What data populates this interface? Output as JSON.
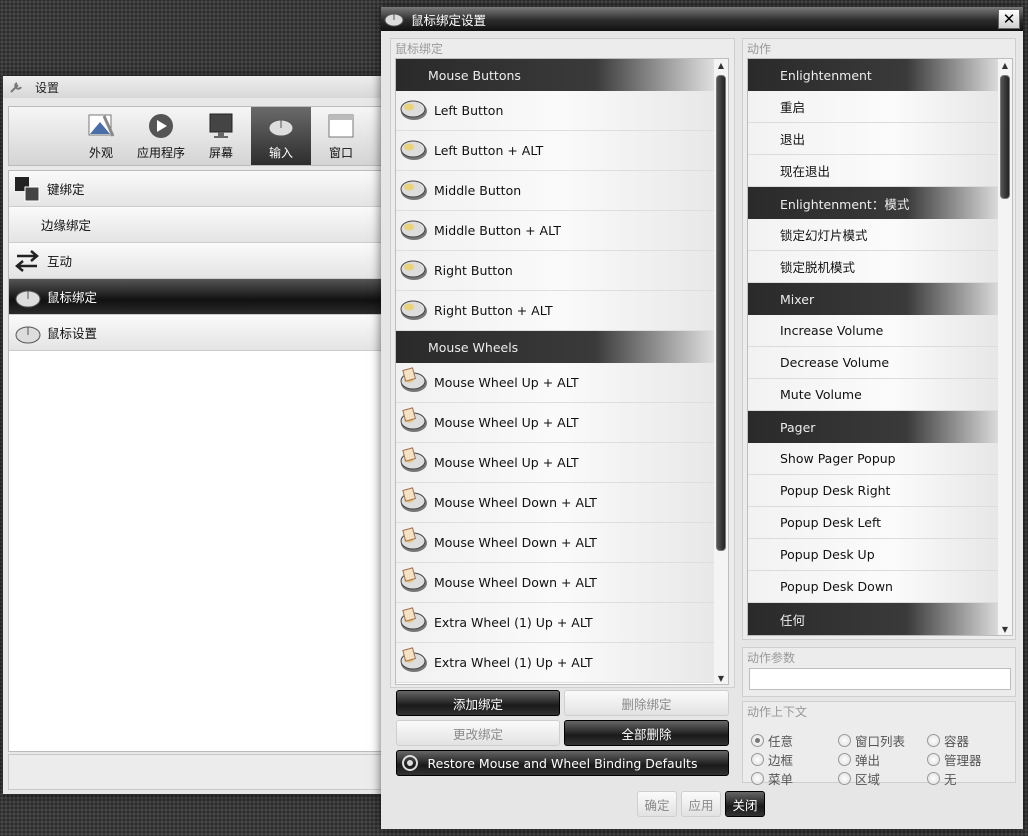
{
  "settings_window": {
    "title": "设置",
    "toolbar": [
      {
        "label": "外观",
        "icon": "appearance-icon",
        "active": false
      },
      {
        "label": "应用程序",
        "icon": "play-icon",
        "active": false
      },
      {
        "label": "屏幕",
        "icon": "monitor-icon",
        "active": false
      },
      {
        "label": "输入",
        "icon": "mouse-icon",
        "active": true
      },
      {
        "label": "窗口",
        "icon": "window-icon",
        "active": false
      }
    ],
    "categories": [
      {
        "label": "键绑定",
        "icon": "keyboard-icon",
        "sub": false,
        "selected": false
      },
      {
        "label": "边缘绑定",
        "icon": "",
        "sub": true,
        "selected": false
      },
      {
        "label": "互动",
        "icon": "arrows-icon",
        "sub": false,
        "selected": false
      },
      {
        "label": "鼠标绑定",
        "icon": "mouse-icon",
        "sub": false,
        "selected": true
      },
      {
        "label": "鼠标设置",
        "icon": "mouse-icon",
        "sub": false,
        "selected": false
      }
    ]
  },
  "bind_window": {
    "title": "鼠标绑定设置",
    "close_glyph": "✕",
    "bindings_frame_label": "鼠标绑定",
    "bindings": [
      {
        "type": "header",
        "label": "Mouse Buttons"
      },
      {
        "type": "item",
        "label": "Left Button",
        "icon": "mouse-button-icon"
      },
      {
        "type": "item",
        "label": "Left Button + ALT",
        "icon": "mouse-button-icon"
      },
      {
        "type": "item",
        "label": "Middle Button",
        "icon": "mouse-button-icon"
      },
      {
        "type": "item",
        "label": "Middle Button + ALT",
        "icon": "mouse-button-icon"
      },
      {
        "type": "item",
        "label": "Right Button",
        "icon": "mouse-button-icon"
      },
      {
        "type": "item",
        "label": "Right Button + ALT",
        "icon": "mouse-button-icon"
      },
      {
        "type": "header",
        "label": "Mouse Wheels"
      },
      {
        "type": "item",
        "label": "Mouse Wheel Up + ALT",
        "icon": "mouse-wheel-icon"
      },
      {
        "type": "item",
        "label": "Mouse Wheel Up + ALT",
        "icon": "mouse-wheel-icon"
      },
      {
        "type": "item",
        "label": "Mouse Wheel Up + ALT",
        "icon": "mouse-wheel-icon"
      },
      {
        "type": "item",
        "label": "Mouse Wheel Down + ALT",
        "icon": "mouse-wheel-icon"
      },
      {
        "type": "item",
        "label": "Mouse Wheel Down + ALT",
        "icon": "mouse-wheel-icon"
      },
      {
        "type": "item",
        "label": "Mouse Wheel Down + ALT",
        "icon": "mouse-wheel-icon"
      },
      {
        "type": "item",
        "label": "Extra Wheel (1) Up + ALT",
        "icon": "mouse-wheel-icon"
      },
      {
        "type": "item",
        "label": "Extra Wheel (1) Up + ALT",
        "icon": "mouse-wheel-icon"
      }
    ],
    "buttons": {
      "add": "添加绑定",
      "delete": "删除绑定",
      "modify": "更改绑定",
      "delete_all": "全部删除",
      "restore": "Restore Mouse and Wheel Binding Defaults"
    },
    "actions_frame_label": "动作",
    "actions": [
      {
        "type": "header",
        "label": "Enlightenment"
      },
      {
        "type": "item",
        "label": "重启"
      },
      {
        "type": "item",
        "label": "退出"
      },
      {
        "type": "item",
        "label": "现在退出"
      },
      {
        "type": "header",
        "label": "Enlightenment：模式"
      },
      {
        "type": "item",
        "label": "锁定幻灯片模式"
      },
      {
        "type": "item",
        "label": "锁定脱机模式"
      },
      {
        "type": "header",
        "label": "Mixer"
      },
      {
        "type": "item",
        "label": "Increase Volume"
      },
      {
        "type": "item",
        "label": "Decrease Volume"
      },
      {
        "type": "item",
        "label": "Mute Volume"
      },
      {
        "type": "header",
        "label": "Pager"
      },
      {
        "type": "item",
        "label": "Show Pager Popup"
      },
      {
        "type": "item",
        "label": "Popup Desk Right"
      },
      {
        "type": "item",
        "label": "Popup Desk Left"
      },
      {
        "type": "item",
        "label": "Popup Desk Up"
      },
      {
        "type": "item",
        "label": "Popup Desk Down"
      },
      {
        "type": "header",
        "label": "任何"
      }
    ],
    "params_label": "动作参数",
    "params_value": "",
    "context_label": "动作上下文",
    "contexts": [
      {
        "label": "任意",
        "checked": true
      },
      {
        "label": "窗口列表",
        "checked": false
      },
      {
        "label": "容器",
        "checked": false
      },
      {
        "label": "边框",
        "checked": false
      },
      {
        "label": "弹出",
        "checked": false
      },
      {
        "label": "管理器",
        "checked": false
      },
      {
        "label": "菜单",
        "checked": false
      },
      {
        "label": "区域",
        "checked": false
      },
      {
        "label": "无",
        "checked": false
      }
    ],
    "footer": {
      "ok": "确定",
      "apply": "应用",
      "close": "关闭"
    }
  }
}
